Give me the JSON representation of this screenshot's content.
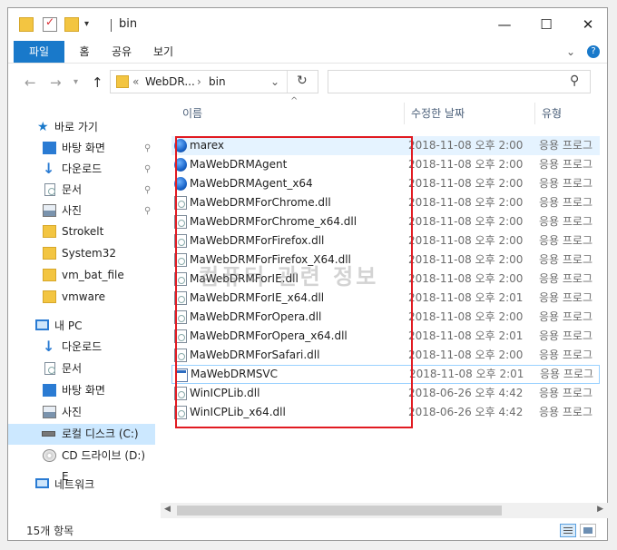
{
  "window": {
    "title": "bin",
    "minimize_glyph": "—",
    "maximize_glyph": "☐",
    "close_glyph": "✕"
  },
  "ribbon": {
    "tabs": [
      "파일",
      "홈",
      "공유",
      "보기"
    ],
    "expand_glyph": "⌄",
    "help_glyph": "?"
  },
  "address": {
    "back_glyph": "←",
    "forward_glyph": "→",
    "up_glyph": "↑",
    "prefix": "«",
    "crumb1": "WebDR...",
    "sep": "›",
    "crumb2": "bin",
    "dropdown_glyph": "⌄",
    "refresh_glyph": "↻",
    "search_placeholder": "",
    "search_glyph": "⚲"
  },
  "sidebar": {
    "quick_access": "바로 가기",
    "items": [
      {
        "label": "바탕 화면",
        "pinned": true
      },
      {
        "label": "다운로드",
        "pinned": true
      },
      {
        "label": "문서",
        "pinned": true
      },
      {
        "label": "사진",
        "pinned": true
      },
      {
        "label": "Strokelt",
        "pinned": false
      },
      {
        "label": "System32",
        "pinned": false
      },
      {
        "label": "vm_bat_file",
        "pinned": false
      },
      {
        "label": "vmware",
        "pinned": false
      }
    ],
    "this_pc": "내 PC",
    "pc_items": [
      "다운로드",
      "문서",
      "바탕 화면",
      "사진",
      "로컬 디스크 (C:)",
      "CD 드라이브 (D:) E"
    ],
    "network": "네트워크",
    "pin_glyph": "📌"
  },
  "columns": {
    "name": "이름",
    "date": "수정한 날짜",
    "type": "유형",
    "sort_glyph": "^"
  },
  "files": [
    {
      "name": "marex",
      "date": "2018-11-08 오후 2:00",
      "type": "응용 프로그",
      "icon": "globe-icon"
    },
    {
      "name": "MaWebDRMAgent",
      "date": "2018-11-08 오후 2:00",
      "type": "응용 프로그",
      "icon": "globe-icon"
    },
    {
      "name": "MaWebDRMAgent_x64",
      "date": "2018-11-08 오후 2:00",
      "type": "응용 프로그",
      "icon": "globe-icon"
    },
    {
      "name": "MaWebDRMForChrome.dll",
      "date": "2018-11-08 오후 2:00",
      "type": "응용 프로그",
      "icon": "dll-icon"
    },
    {
      "name": "MaWebDRMForChrome_x64.dll",
      "date": "2018-11-08 오후 2:00",
      "type": "응용 프로그",
      "icon": "dll-icon"
    },
    {
      "name": "MaWebDRMForFirefox.dll",
      "date": "2018-11-08 오후 2:00",
      "type": "응용 프로그",
      "icon": "dll-icon"
    },
    {
      "name": "MaWebDRMForFirefox_X64.dll",
      "date": "2018-11-08 오후 2:00",
      "type": "응용 프로그",
      "icon": "dll-icon"
    },
    {
      "name": "MaWebDRMForIE.dll",
      "date": "2018-11-08 오후 2:00",
      "type": "응용 프로그",
      "icon": "dll-icon"
    },
    {
      "name": "MaWebDRMForIE_x64.dll",
      "date": "2018-11-08 오후 2:01",
      "type": "응용 프로그",
      "icon": "dll-icon"
    },
    {
      "name": "MaWebDRMForOpera.dll",
      "date": "2018-11-08 오후 2:00",
      "type": "응용 프로그",
      "icon": "dll-icon"
    },
    {
      "name": "MaWebDRMForOpera_x64.dll",
      "date": "2018-11-08 오후 2:01",
      "type": "응용 프로그",
      "icon": "dll-icon"
    },
    {
      "name": "MaWebDRMForSafari.dll",
      "date": "2018-11-08 오후 2:00",
      "type": "응용 프로그",
      "icon": "dll-icon"
    },
    {
      "name": "MaWebDRMSVC",
      "date": "2018-11-08 오후 2:01",
      "type": "응용 프로그",
      "icon": "service-icon"
    },
    {
      "name": "WinICPLib.dll",
      "date": "2018-06-26 오후 4:42",
      "type": "응용 프로그",
      "icon": "dll-icon"
    },
    {
      "name": "WinICPLib_x64.dll",
      "date": "2018-06-26 오후 4:42",
      "type": "응용 프로그",
      "icon": "dll-icon"
    }
  ],
  "status": {
    "count": "15개 항목"
  },
  "watermark": "컴퓨터 관련 정보",
  "colors": {
    "accent": "#1979ca",
    "highlight_box": "#e11b22",
    "selection": "#cce8ff"
  }
}
